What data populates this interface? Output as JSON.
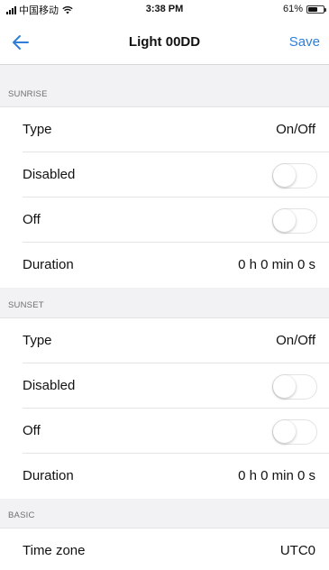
{
  "status_bar": {
    "carrier": "中国移动",
    "time": "3:38 PM",
    "battery": "61%",
    "battery_level": 0.61,
    "signal_icon": "signal-bars-icon",
    "wifi_icon": "wifi-icon",
    "battery_icon": "battery-icon"
  },
  "nav": {
    "back_icon": "arrow-left-icon",
    "title": "Light 00DD",
    "save_label": "Save",
    "accent_color": "#2f7fd8"
  },
  "sections": {
    "sunrise": {
      "header": "SUNRISE",
      "type_label": "Type",
      "type_value": "On/Off",
      "disabled_label": "Disabled",
      "disabled_on": false,
      "off_label": "Off",
      "off_on": false,
      "duration_label": "Duration",
      "duration_value": "0 h 0 min 0 s"
    },
    "sunset": {
      "header": "SUNSET",
      "type_label": "Type",
      "type_value": "On/Off",
      "disabled_label": "Disabled",
      "disabled_on": false,
      "off_label": "Off",
      "off_on": false,
      "duration_label": "Duration",
      "duration_value": "0 h 0 min 0 s"
    },
    "basic": {
      "header": "BASIC",
      "timezone_label": "Time zone",
      "timezone_value": "UTC0"
    }
  }
}
